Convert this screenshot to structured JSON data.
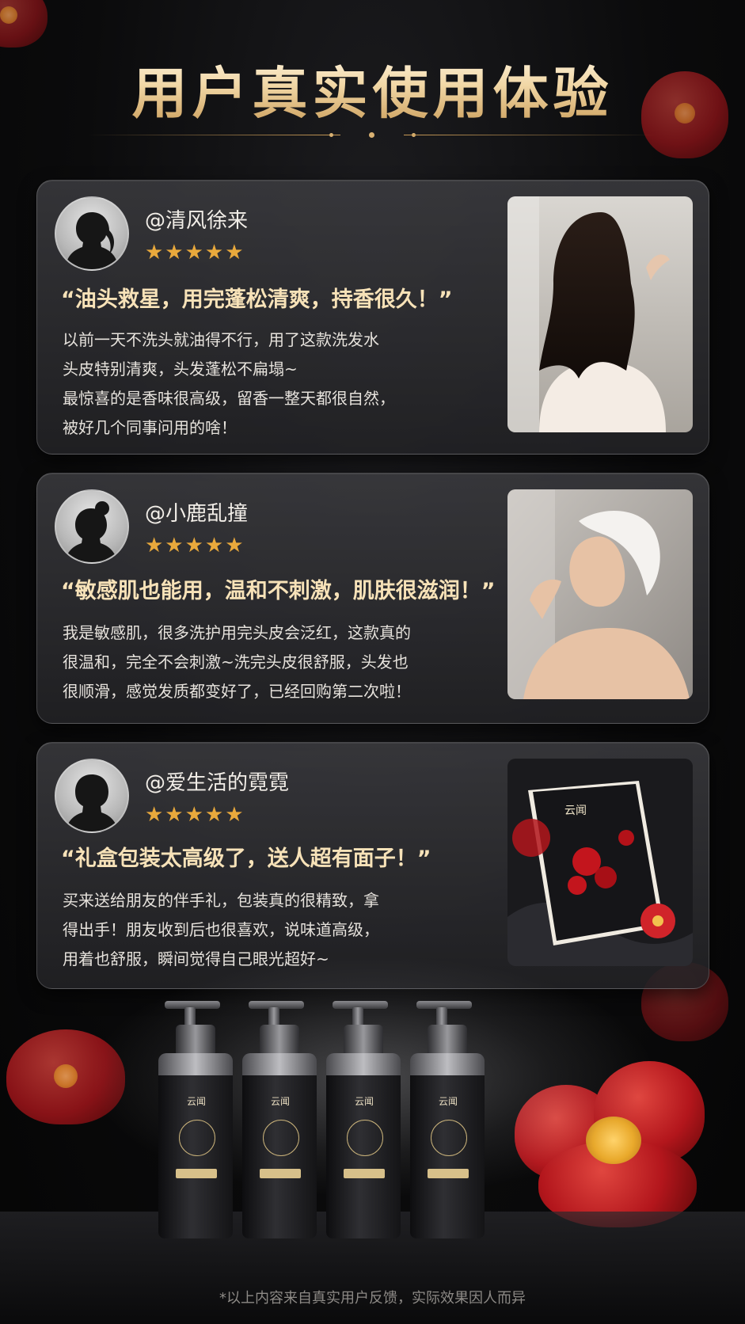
{
  "header": {
    "title": "用户真实使用体验"
  },
  "reviews": [
    {
      "username": "@清风徐来",
      "stars": "★★★★★",
      "rating": 5,
      "quote": "“油头救星，用完蓬松清爽，持香很久！”",
      "body_lines": [
        "以前一天不洗头就油得不行，用了这款洗发水",
        "头皮特别清爽，头发蓬松不扁塌~",
        "最惊喜的是香味很高级，留香一整天都很自然，",
        "被好几个同事问用的啥！"
      ],
      "avatar_icon": "female-silhouette-ponytail-icon",
      "photo": "woman-long-wavy-hair-photo"
    },
    {
      "username": "@小鹿乱撞",
      "stars": "★★★★★",
      "rating": 5,
      "quote": "“敏感肌也能用，温和不刺激，肌肤很滋润！”",
      "body_lines": [
        "我是敏感肌，很多洗护用完头皮会泛红，这款真的",
        "很温和，完全不会刺激~洗完头皮很舒服，头发也",
        "很顺滑，感觉发质都变好了，已经回购第二次啦！"
      ],
      "avatar_icon": "female-silhouette-bun-icon",
      "photo": "woman-washing-hair-photo"
    },
    {
      "username": "@爱生活的霓霓",
      "stars": "★★★★★",
      "rating": 5,
      "quote": "“礼盒包装太高级了，送人超有面子！”",
      "body_lines": [
        "买来送给朋友的伴手礼，包装真的很精致，拿",
        "得出手！朋友收到后也很喜欢，说味道高级，",
        "用着也舒服，瞬间觉得自己眼光超好~"
      ],
      "avatar_icon": "female-silhouette-short-hair-icon",
      "photo": "gift-box-camellia-photo"
    }
  ],
  "product": {
    "bottle_brand": "云闻",
    "bottle_count": 4
  },
  "footnote": "*以上内容来自真实用户反馈，实际效果因人而异",
  "colors": {
    "gold": "#c99b57",
    "star": "#e9a93c",
    "quote": "#f7e2b8",
    "flower_red": "#b3161c"
  }
}
